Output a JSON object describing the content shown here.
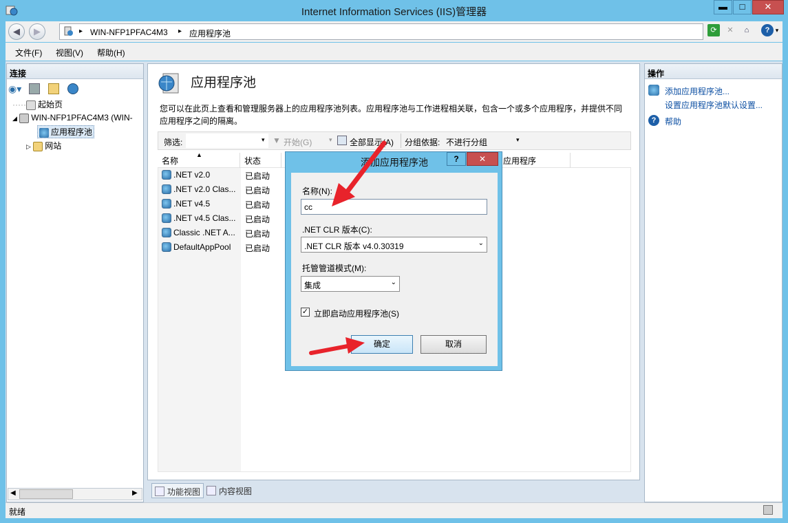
{
  "window": {
    "title": "Internet Information Services (IIS)管理器",
    "minimize": "▬",
    "maximize": "□",
    "close": "✕"
  },
  "address": {
    "segments": [
      "WIN-NFP1PFAC4M3",
      "应用程序池"
    ],
    "separator": "▸"
  },
  "menu": [
    "文件(F)",
    "视图(V)",
    "帮助(H)"
  ],
  "left": {
    "title": "连接",
    "tree": {
      "start": "起始页",
      "server": "WIN-NFP1PFAC4M3 (WIN-",
      "pools": "应用程序池",
      "sites": "网站"
    }
  },
  "center": {
    "title": "应用程序池",
    "description": "您可以在此页上查看和管理服务器上的应用程序池列表。应用程序池与工作进程相关联，包含一个或多个应用程序，并提供不同应用程序之间的隔离。",
    "filter_label": "筛选:",
    "start_label": "开始(G)",
    "show_all_label": "全部显示(A)",
    "group_label": "分组依据:",
    "group_value": "不进行分组",
    "columns": [
      "名称",
      "状态",
      "应用程序"
    ],
    "rows": [
      {
        "name": ".NET v2.0",
        "status": "已启动"
      },
      {
        "name": ".NET v2.0 Clas...",
        "status": "已启动"
      },
      {
        "name": ".NET v4.5",
        "status": "已启动"
      },
      {
        "name": ".NET v4.5 Clas...",
        "status": "已启动"
      },
      {
        "name": "Classic .NET A...",
        "status": "已启动"
      },
      {
        "name": "DefaultAppPool",
        "status": "已启动"
      }
    ],
    "tabs": [
      "功能视图",
      "内容视图"
    ]
  },
  "right": {
    "title": "操作",
    "actions": [
      "添加应用程序池...",
      "设置应用程序池默认设置...",
      "帮助"
    ]
  },
  "status": {
    "text": "就绪"
  },
  "dialog": {
    "title": "添加应用程序池",
    "help": "?",
    "close": "✕",
    "name_label": "名称(N):",
    "name_value": "cc",
    "clr_label": ".NET CLR 版本(C):",
    "clr_value": ".NET CLR 版本 v4.0.30319",
    "pipeline_label": "托管管道模式(M):",
    "pipeline_value": "集成",
    "autostart_label": "立即启动应用程序池(S)",
    "autostart_checked": true,
    "ok_label": "确定",
    "cancel_label": "取消"
  },
  "colors": {
    "frame": "#6fc1e8",
    "close": "#c75050",
    "link": "#0b4ea2",
    "arrow": "#e8232b"
  }
}
